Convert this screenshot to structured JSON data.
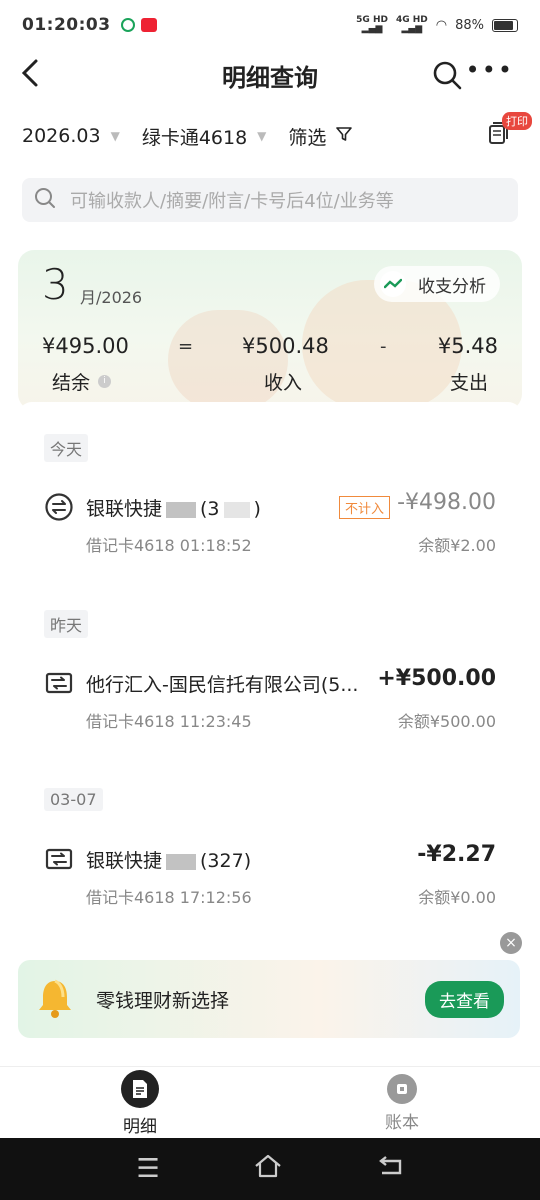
{
  "status_bar": {
    "time": "01:20:03",
    "net1": "5G HD",
    "net2": "4G HD",
    "battery": "88%"
  },
  "nav": {
    "title": "明细查询"
  },
  "filter": {
    "month": "2026.03",
    "account": "绿卡通4618",
    "filter_label": "筛选",
    "print_badge": "打印"
  },
  "search": {
    "placeholder": "可输收款人/摘要/附言/卡号后4位/业务等"
  },
  "summary": {
    "month_num": "3",
    "month_suffix": "月/2026",
    "analysis_label": "收支分析",
    "balance": "¥495.00",
    "eq": "=",
    "income": "¥500.48",
    "minus": "-",
    "expense": "¥5.48",
    "balance_label": "结余",
    "income_label": "收入",
    "expense_label": "支出"
  },
  "groups": [
    {
      "date": "今天",
      "txn": {
        "title_a": "银联快捷",
        "title_b": "(3",
        "title_c": ")",
        "tag": "不计入",
        "amount": "-¥498.00",
        "sub": "借记卡4618 01:18:52",
        "balance": "余额¥2.00"
      }
    },
    {
      "date": "昨天",
      "txn": {
        "title": "他行汇入-国民信托有限公司(5...",
        "amount": "+¥500.00",
        "sub": "借记卡4618 11:23:45",
        "balance": "余额¥500.00"
      }
    },
    {
      "date": "03-07",
      "txn": {
        "title_a": "银联快捷",
        "title_b": "(327)",
        "amount": "-¥2.27",
        "sub": "借记卡4618 17:12:56",
        "balance": "余额¥0.00"
      }
    }
  ],
  "promo": {
    "text": "零钱理财新选择",
    "button": "去查看"
  },
  "tabs": [
    {
      "label": "明细"
    },
    {
      "label": "账本"
    }
  ],
  "colors": {
    "brand_green": "#1a9a58",
    "positive": "#222222",
    "tag_orange": "#f08a3c"
  }
}
